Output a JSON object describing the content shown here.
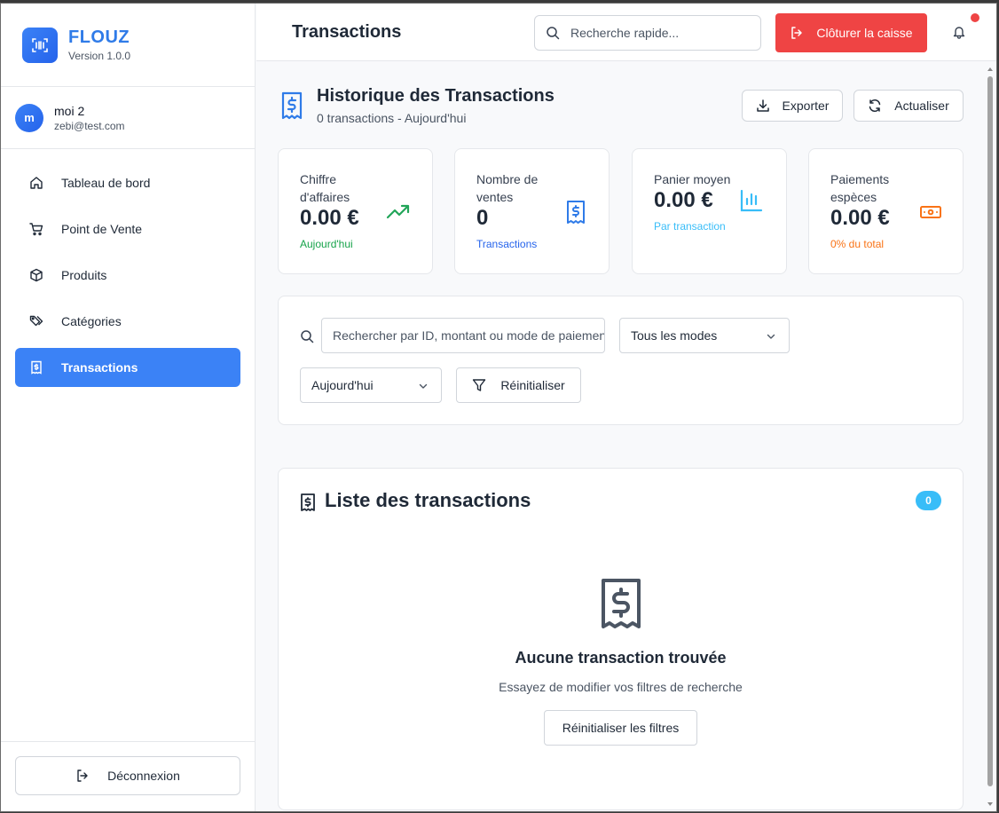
{
  "app": {
    "name": "FLOUZ",
    "version": "Version 1.0.0"
  },
  "user": {
    "initial": "m",
    "name": "moi 2",
    "email": "zebi@test.com"
  },
  "sidebar": {
    "items": [
      {
        "label": "Tableau de bord",
        "icon": "home-icon"
      },
      {
        "label": "Point de Vente",
        "icon": "cart-icon"
      },
      {
        "label": "Produits",
        "icon": "box-icon"
      },
      {
        "label": "Catégories",
        "icon": "tags-icon"
      },
      {
        "label": "Transactions",
        "icon": "receipt-icon",
        "active": true
      }
    ],
    "logout_label": "Déconnexion"
  },
  "header": {
    "title": "Transactions",
    "search_placeholder": "Recherche rapide...",
    "close_register_label": "Clôturer la caisse",
    "has_notification": true
  },
  "history": {
    "title": "Historique des Transactions",
    "subtitle": "0 transactions - Aujourd'hui",
    "export_label": "Exporter",
    "refresh_label": "Actualiser"
  },
  "stats": [
    {
      "label": "Chiffre d'affaires",
      "value": "0.00 €",
      "sub": "Aujourd'hui",
      "color": "#16a34a",
      "icon": "trending-up-icon"
    },
    {
      "label": "Nombre de ventes",
      "value": "0",
      "sub": "Transactions",
      "color": "#2563eb",
      "icon": "receipt-icon"
    },
    {
      "label": "Panier moyen",
      "value": "0.00 €",
      "sub": "Par transaction",
      "color": "#38bdf8",
      "icon": "bar-chart-icon"
    },
    {
      "label": "Paiements espèces",
      "value": "0.00 €",
      "sub": "0% du total",
      "color": "#f97316",
      "icon": "banknote-icon"
    }
  ],
  "filters": {
    "search_placeholder": "Rechercher par ID, montant ou mode de paiement",
    "mode_selected": "Tous les modes",
    "date_selected": "Aujourd'hui",
    "reset_label": "Réinitialiser"
  },
  "list": {
    "title": "Liste des transactions",
    "count": "0",
    "empty_title": "Aucune transaction trouvée",
    "empty_sub": "Essayez de modifier vos filtres de recherche",
    "empty_reset_label": "Réinitialiser les filtres"
  },
  "colors": {
    "primary": "#3b82f6",
    "danger": "#ef4444",
    "badge": "#38bdf8"
  }
}
